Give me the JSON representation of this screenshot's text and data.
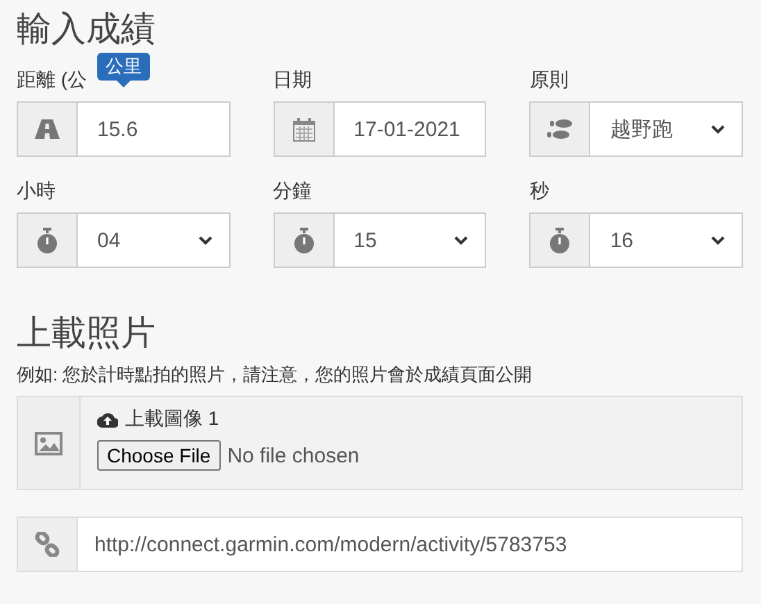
{
  "heading": "輸入成績",
  "fields": [
    {
      "label": "距離 (公",
      "kind": "text",
      "value": "15.6",
      "tooltip": "公里"
    },
    {
      "label": "日期",
      "kind": "text",
      "value": "17-01-2021"
    },
    {
      "label": "原則",
      "kind": "select",
      "value": "越野跑"
    },
    {
      "label": "小時",
      "kind": "select",
      "value": "04"
    },
    {
      "label": "分鐘",
      "kind": "select",
      "value": "15"
    },
    {
      "label": "秒",
      "kind": "select",
      "value": "16"
    }
  ],
  "photos": {
    "heading": "上載照片",
    "hint": "例如: 您於計時點拍的照片，請注意，您的照片會於成績頁面公開",
    "upload_label": "上載圖像 1",
    "button": "Choose File",
    "status": "No file chosen"
  },
  "link_field": {
    "value": "http://connect.garmin.com/modern/activity/5783753"
  }
}
